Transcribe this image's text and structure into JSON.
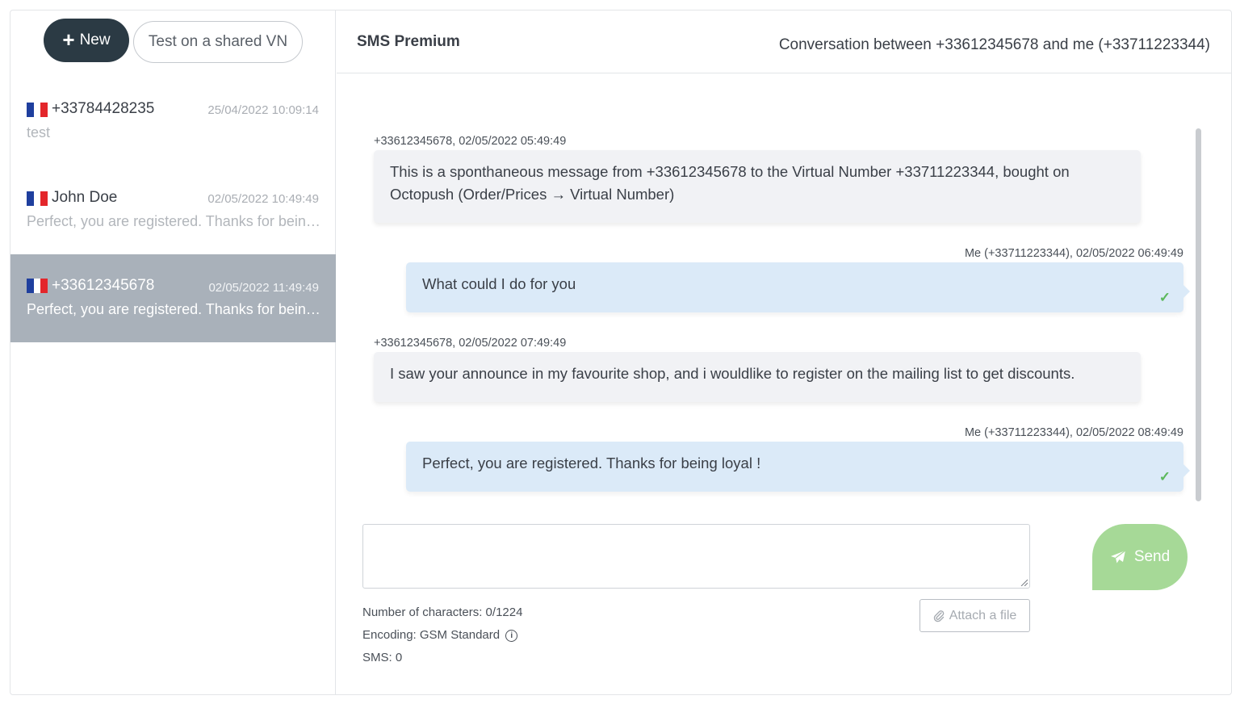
{
  "sidebar": {
    "new_label": "New",
    "test_label": "Test on a shared VN",
    "conversations": [
      {
        "name": "+33784428235",
        "date": "25/04/2022 10:09:14",
        "preview": "test"
      },
      {
        "name": "John Doe",
        "date": "02/05/2022 10:49:49",
        "preview": "Perfect, you are registered. Thanks for being loyal !"
      },
      {
        "name": "+33612345678",
        "date": "02/05/2022 11:49:49",
        "preview": "Perfect, you are registered. Thanks for being loyal !"
      }
    ]
  },
  "header": {
    "title": "SMS Premium",
    "conversation": "Conversation between +33612345678 and me (+33711223344)"
  },
  "messages": [
    {
      "meta": "+33612345678, 02/05/2022 05:49:49",
      "lines": [
        "This is a sponthaneous message from +33612345678 to the Virtual Number +33711223344, bought on",
        "Octopush (Order/Prices → Virtual Number)"
      ]
    },
    {
      "meta": "Me (+33711223344), 02/05/2022 06:49:49",
      "text": "What could I do for you"
    },
    {
      "meta": "+33612345678, 02/05/2022 07:49:49",
      "text": "I saw your announce in my favourite shop, and i wouldlike to register on the mailing list to get discounts."
    },
    {
      "meta": "Me (+33711223344), 02/05/2022 08:49:49",
      "text": "Perfect, you are registered. Thanks for being loyal !"
    }
  ],
  "composer": {
    "char_count": "Number of characters: 0/1224",
    "encoding": "Encoding: GSM Standard",
    "sms_count": "SMS: 0",
    "attach_label": "Attach a file",
    "send_label": "Send"
  },
  "colors": {
    "new_button": "#2b3a44",
    "active_conversation": "#a9b1ba",
    "outgoing_bubble": "#dbeaf8",
    "incoming_bubble": "#f1f2f5",
    "send_button": "#a6d997",
    "check": "#5cb85c"
  },
  "icons": {
    "new": "plus-icon",
    "flag": "france-flag-icon",
    "delivered": "check-icon",
    "info": "info-icon",
    "attach": "paperclip-icon",
    "send": "paper-plane-icon"
  }
}
